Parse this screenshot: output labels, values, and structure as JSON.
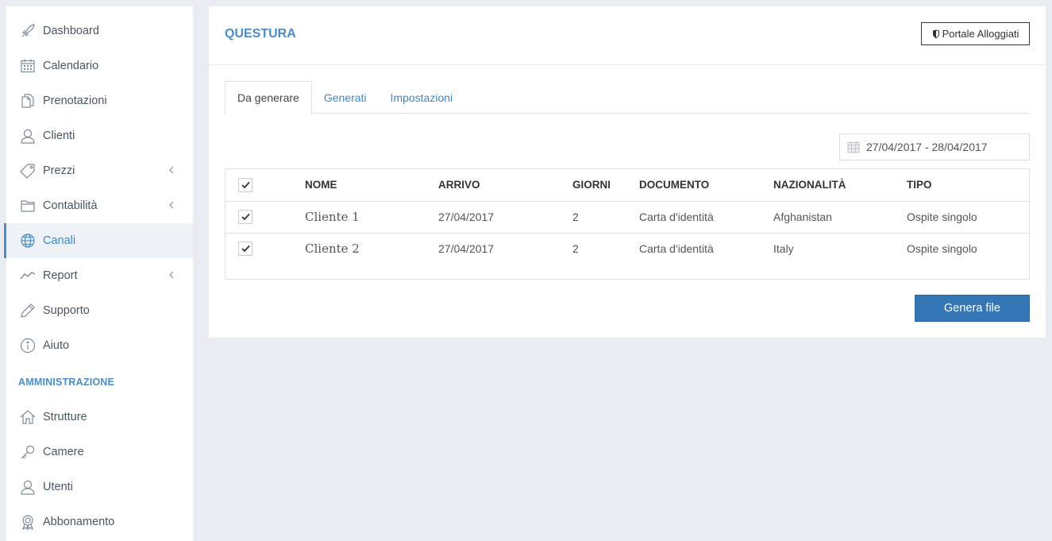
{
  "sidebar": {
    "items": [
      {
        "label": "Dashboard",
        "icon": "rocket-icon"
      },
      {
        "label": "Calendario",
        "icon": "calendar-icon"
      },
      {
        "label": "Prenotazioni",
        "icon": "documents-icon"
      },
      {
        "label": "Clienti",
        "icon": "user-icon"
      },
      {
        "label": "Prezzi",
        "icon": "tag-icon"
      },
      {
        "label": "Contabilità",
        "icon": "folder-icon"
      },
      {
        "label": "Canali",
        "icon": "globe-icon"
      },
      {
        "label": "Report",
        "icon": "trend-icon"
      },
      {
        "label": "Supporto",
        "icon": "pencil-icon"
      },
      {
        "label": "Aiuto",
        "icon": "info-icon"
      }
    ],
    "section_title": "AMMINISTRAZIONE",
    "admin_items": [
      {
        "label": "Strutture",
        "icon": "home-icon"
      },
      {
        "label": "Camere",
        "icon": "key-icon"
      },
      {
        "label": "Utenti",
        "icon": "user-icon"
      },
      {
        "label": "Abbonamento",
        "icon": "badge-icon"
      }
    ],
    "active": "Canali",
    "colors": {
      "accent": "#4d8cc8",
      "active_bg": "#eef2f7"
    }
  },
  "header": {
    "title": "QUESTURA",
    "portal_button": "Portale Alloggiati"
  },
  "tabs": [
    {
      "label": "Da generare",
      "active": true
    },
    {
      "label": "Generati",
      "active": false
    },
    {
      "label": "Impostazioni",
      "active": false
    }
  ],
  "date_range": "27/04/2017 - 28/04/2017",
  "table": {
    "columns": [
      "NOME",
      "ARRIVO",
      "GIORNI",
      "DOCUMENTO",
      "NAZIONALITÀ",
      "TIPO"
    ],
    "select_all_checked": true,
    "rows": [
      {
        "checked": true,
        "nome": "Cliente 1",
        "arrivo": "27/04/2017",
        "giorni": "2",
        "documento": "Carta d'identità",
        "nazionalita": "Afghanistan",
        "tipo": "Ospite singolo"
      },
      {
        "checked": true,
        "nome": "Cliente 2",
        "arrivo": "27/04/2017",
        "giorni": "2",
        "documento": "Carta d'identità",
        "nazionalita": "Italy",
        "tipo": "Ospite singolo"
      }
    ]
  },
  "actions": {
    "generate_button": "Genera file",
    "primary_color": "#3476b5"
  }
}
